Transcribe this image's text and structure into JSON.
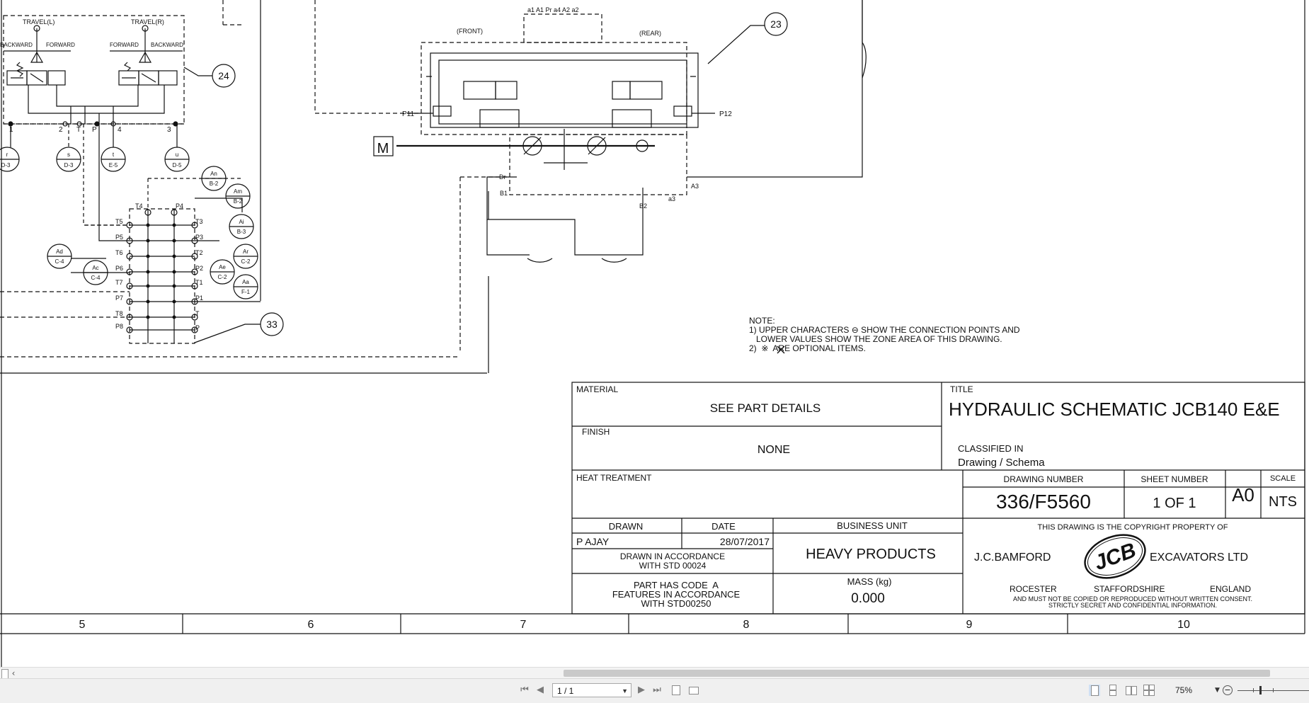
{
  "drawing": {
    "callouts": [
      "24",
      "23",
      "33"
    ],
    "travel_left": "TRAVEL(L)",
    "travel_right": "TRAVEL(R)",
    "backward": "BACKWARD",
    "forward": "FORWARD",
    "front": "(FRONT)",
    "rear": "(REAR)",
    "motor": "M",
    "port_labels": {
      "p11": "P11",
      "p12": "P12",
      "dr": "Dr",
      "b1": "B1",
      "b2": "B2",
      "a3": "A3",
      "a3_lower": "a3",
      "top_ports": "a1 A1 Pr a4 A2 a2"
    },
    "pedal_ports": [
      "1",
      "2",
      "T",
      "P",
      "4",
      "3"
    ],
    "zone_circles": [
      {
        "top": "r",
        "bottom": "D-3"
      },
      {
        "top": "s",
        "bottom": "D-3"
      },
      {
        "top": "t",
        "bottom": "E-5"
      },
      {
        "top": "u",
        "bottom": "D-5"
      },
      {
        "top": "An",
        "bottom": "B-2"
      },
      {
        "top": "Am",
        "bottom": "B-2"
      },
      {
        "top": "Ai",
        "bottom": "B-3"
      },
      {
        "top": "Ar",
        "bottom": "C-2"
      },
      {
        "top": "Ae",
        "bottom": "C-2"
      },
      {
        "top": "Aa",
        "bottom": "F-1"
      },
      {
        "top": "Ad",
        "bottom": "C-4"
      },
      {
        "top": "Ac",
        "bottom": "C-4"
      }
    ],
    "manifold_left_ports": [
      "T5",
      "P5",
      "T6",
      "P6",
      "T7",
      "P7",
      "T8",
      "P8"
    ],
    "manifold_right_ports": [
      "T3",
      "P3",
      "T2",
      "P2",
      "T1",
      "P1",
      "T",
      "P"
    ],
    "manifold_top_ports": [
      "T4",
      "P4"
    ],
    "note_title": "NOTE:",
    "note_lines": [
      "1) UPPER CHARACTERS ⊖ SHOW THE CONNECTION POINTS AND",
      "   LOWER VALUES SHOW THE ZONE AREA OF THIS DRAWING.",
      "2)  ※  ARE OPTIONAL ITEMS."
    ]
  },
  "title_block": {
    "material_label": "MATERIAL",
    "material_value": "SEE PART DETAILS",
    "finish_label": "FINISH",
    "finish_value": "NONE",
    "heat_treatment_label": "HEAT TREATMENT",
    "title_label": "TITLE",
    "title_value": "HYDRAULIC SCHEMATIC JCB140 E&E",
    "classified_label": "CLASSIFIED IN",
    "classified_value": "Drawing / Schema",
    "drawing_number_label": "DRAWING NUMBER",
    "drawing_number_value": "336/F5560",
    "sheet_number_label": "SHEET NUMBER",
    "sheet_number_value": "1 OF 1",
    "size_value": "A0",
    "scale_label": "SCALE",
    "scale_value": "NTS",
    "drawn_label": "DRAWN",
    "drawn_value": "P AJAY",
    "date_label": "DATE",
    "date_value": "28/07/2017",
    "drawn_std_line1": "DRAWN IN ACCORDANCE",
    "drawn_std_line2": "WITH STD 00024",
    "business_unit_label": "BUSINESS UNIT",
    "business_unit_value": "HEAVY PRODUCTS",
    "part_code_line1": "PART HAS CODE  A",
    "part_code_line2": "FEATURES IN ACCORDANCE",
    "part_code_line3": "WITH STD00250",
    "mass_label": "MASS (kg)",
    "mass_value": "0.000",
    "copyright_line1": "THIS DRAWING IS THE COPYRIGHT PROPERTY OF",
    "company_left": "J.C.BAMFORD",
    "company_right": "EXCAVATORS LTD",
    "logo_text": "JCB",
    "location_left": "ROCESTER",
    "location_mid": "STAFFORDSHIRE",
    "location_right": "ENGLAND",
    "copyright_line2": "AND MUST NOT BE COPIED OR REPRODUCED WITHOUT WRITTEN CONSENT.",
    "copyright_line3": "STRICTLY SECRET AND CONFIDENTIAL INFORMATION."
  },
  "zone_ruler": [
    "5",
    "6",
    "7",
    "8",
    "9",
    "10"
  ],
  "viewer": {
    "page_indicator": "1 / 1",
    "zoom_level": "75%",
    "icons": [
      "first-page-icon",
      "prev-page-icon",
      "next-page-icon",
      "last-page-icon",
      "fit-page-icon",
      "fit-width-icon",
      "single-page-view-icon",
      "continuous-view-icon",
      "two-page-view-icon",
      "two-page-continuous-view-icon",
      "zoom-out-icon"
    ]
  }
}
